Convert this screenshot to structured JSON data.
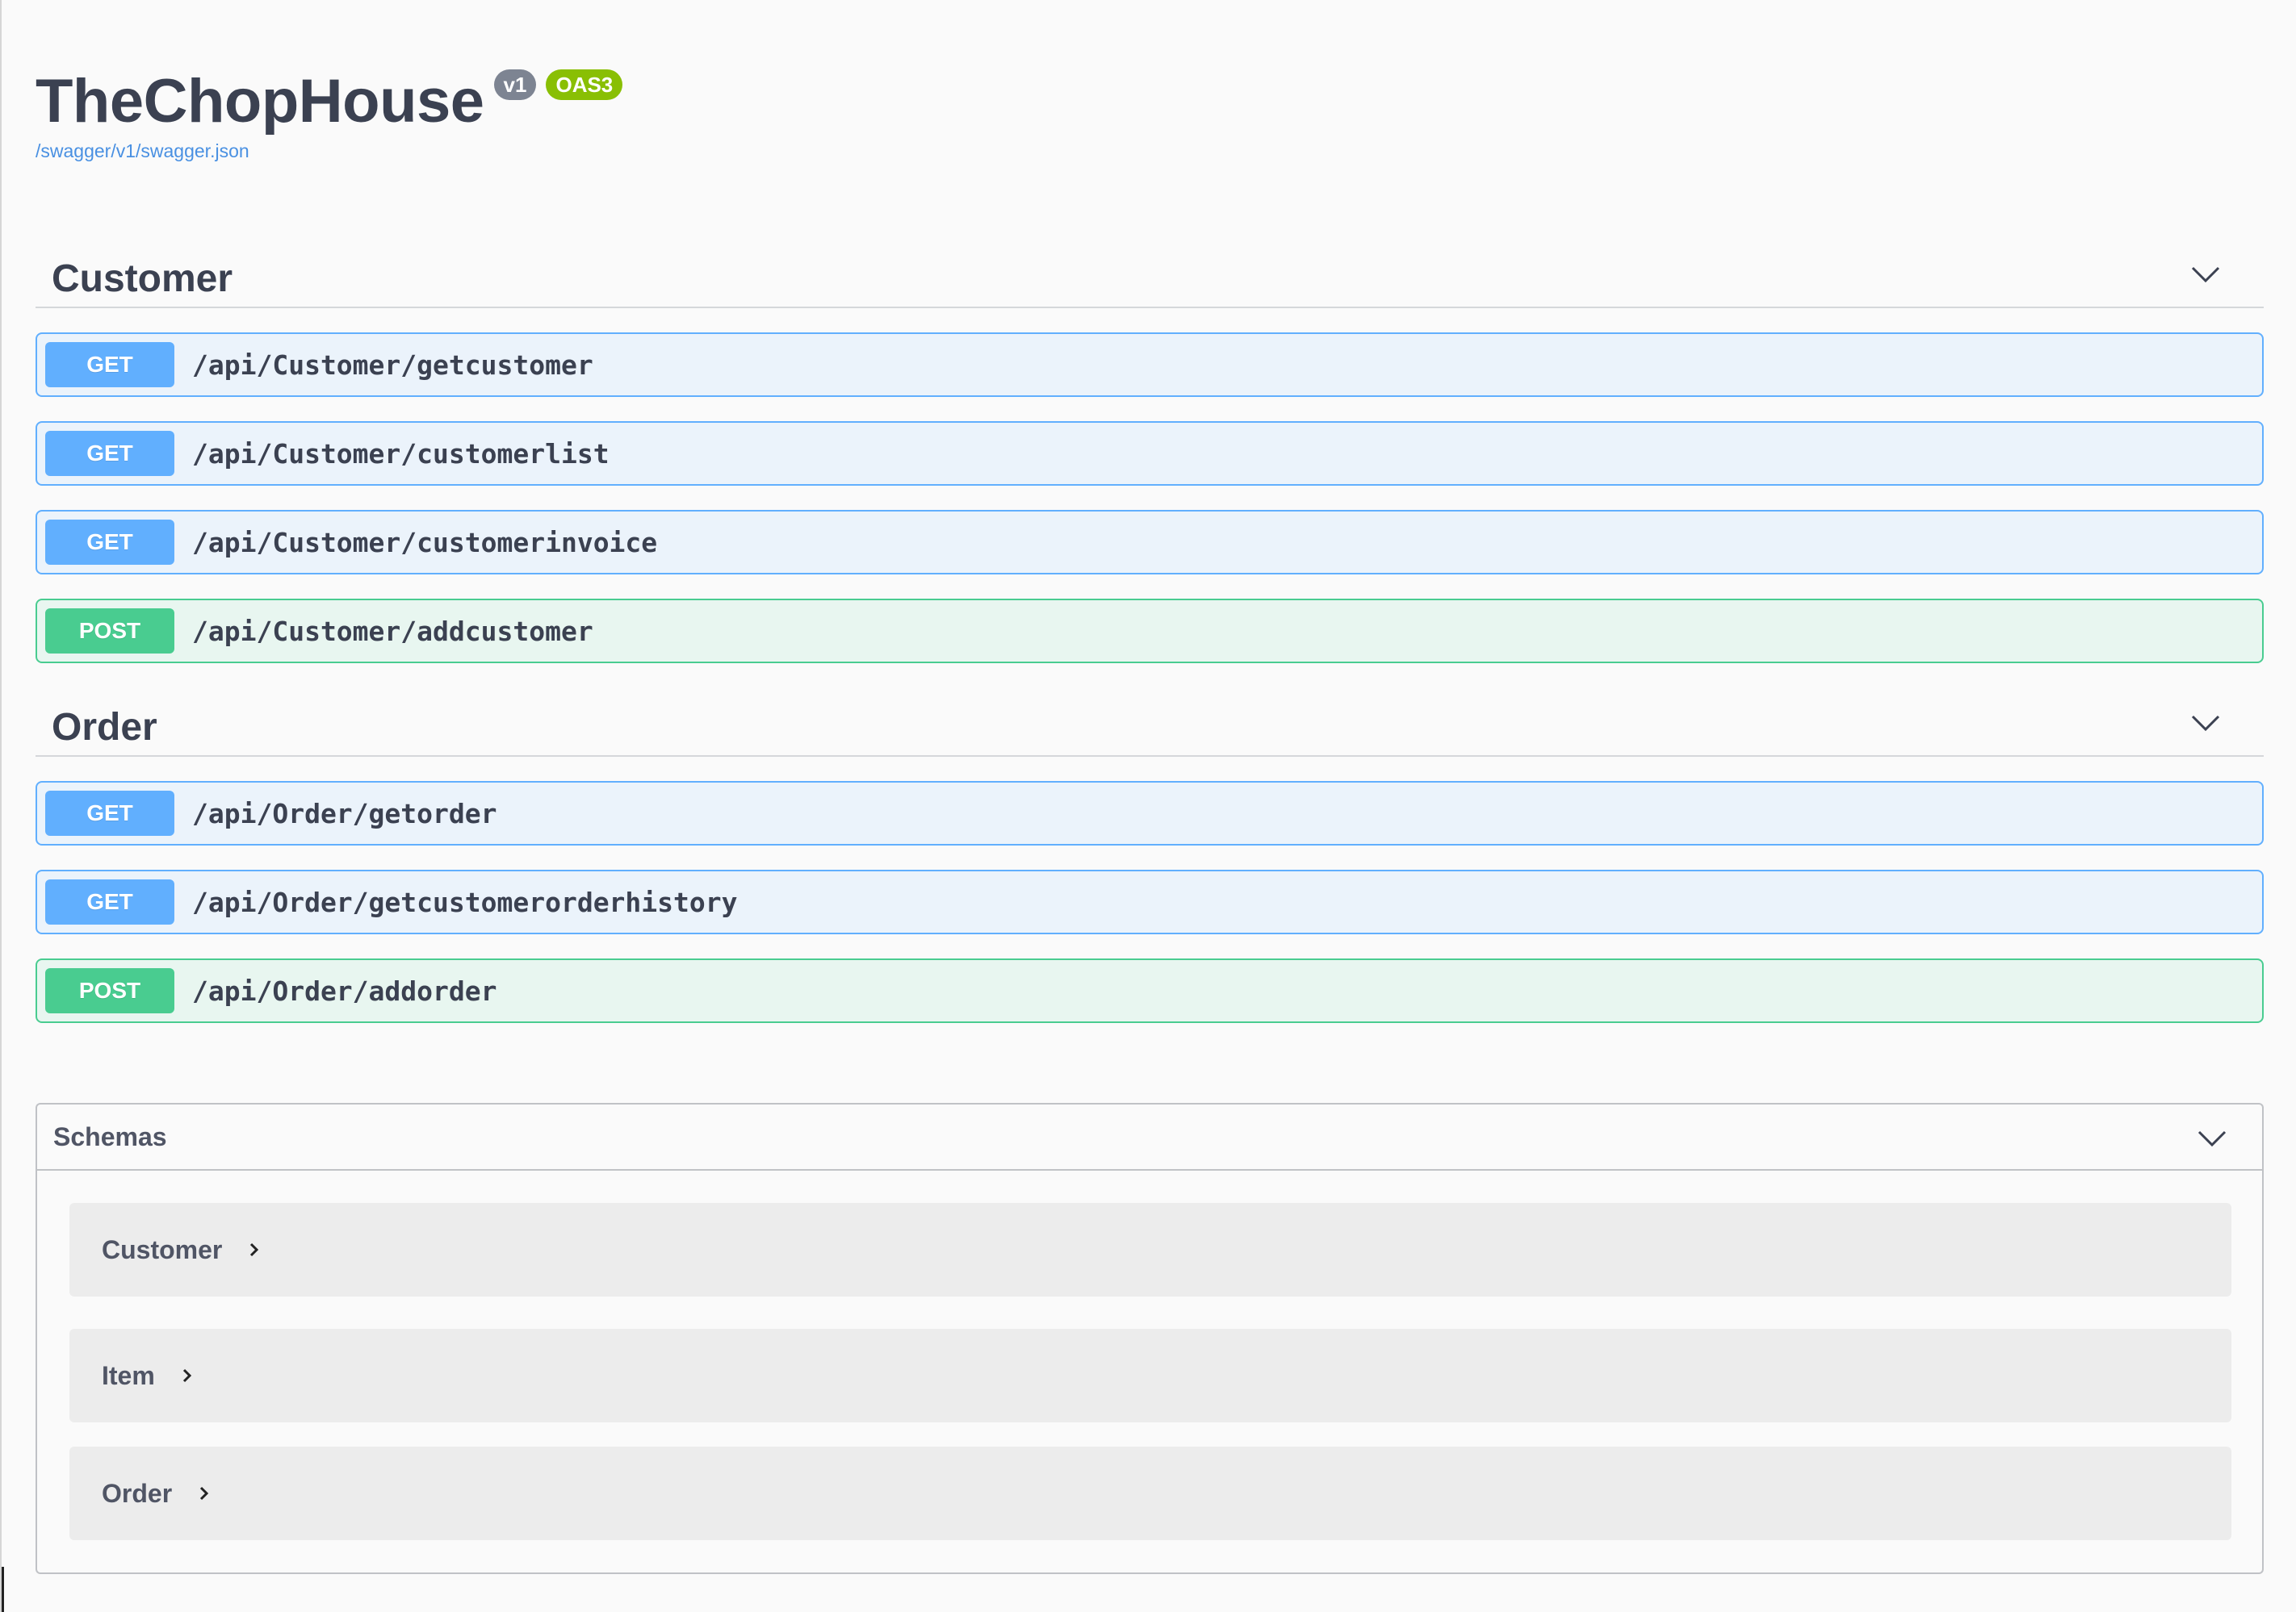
{
  "info": {
    "title": "TheChopHouse",
    "version_badge": "v1",
    "oas_badge": "OAS3",
    "spec_url": "/swagger/v1/swagger.json"
  },
  "tags": [
    {
      "name": "Customer",
      "operations": [
        {
          "method": "GET",
          "path": "/api/Customer/getcustomer"
        },
        {
          "method": "GET",
          "path": "/api/Customer/customerlist"
        },
        {
          "method": "GET",
          "path": "/api/Customer/customerinvoice"
        },
        {
          "method": "POST",
          "path": "/api/Customer/addcustomer"
        }
      ]
    },
    {
      "name": "Order",
      "operations": [
        {
          "method": "GET",
          "path": "/api/Order/getorder"
        },
        {
          "method": "GET",
          "path": "/api/Order/getcustomerorderhistory"
        },
        {
          "method": "POST",
          "path": "/api/Order/addorder"
        }
      ]
    }
  ],
  "schemas": {
    "title": "Schemas",
    "models": [
      {
        "name": "Customer"
      },
      {
        "name": "Item"
      },
      {
        "name": "Order"
      }
    ]
  },
  "colors": {
    "get": "#61affe",
    "post": "#49cc90",
    "link": "#4990e2",
    "text": "#3b4151"
  },
  "icons": {
    "section_toggle": "chevron-down-icon",
    "model_expand": "chevron-right-icon"
  }
}
